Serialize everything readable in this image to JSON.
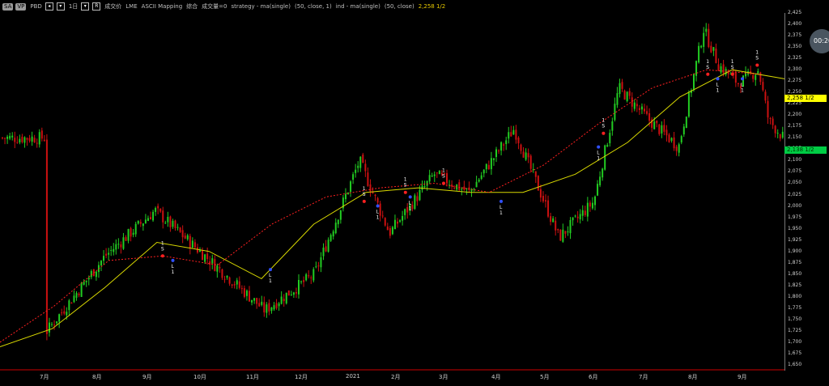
{
  "toolbar": {
    "symbol_badge": "SA",
    "vp_badge": "VP",
    "pbd_label": "PBD",
    "timeframe": "1日",
    "trade_label": "成交价",
    "exchange": "LME",
    "mapping": "ASCII Mapping",
    "composite": "综合",
    "volume_label": "成交量=0",
    "strategy_label": "strategy - ma(single)",
    "strategy_params": "(50, close, 1)",
    "ind_label": "ind - ma(single)",
    "ind_params": "(50, close)",
    "last_value": "2,258 1/2"
  },
  "clock": "00:20",
  "price_axis": {
    "ticks": [
      "2,425",
      "2,400",
      "2,375",
      "2,350",
      "2,325",
      "2,300",
      "2,275",
      "2,250",
      "2,225",
      "2,200",
      "2,175",
      "2,150",
      "2,125",
      "2,100",
      "2,075",
      "2,050",
      "2,025",
      "2,000",
      "1,975",
      "1,950",
      "1,925",
      "1,900",
      "1,875",
      "1,850",
      "1,825",
      "1,800",
      "1,775",
      "1,750",
      "1,725",
      "1,700",
      "1,675",
      "1,650"
    ],
    "last_tag": "2,258 1/2",
    "ma_tag": "2,138 1/2"
  },
  "date_axis": {
    "labels": [
      "7月",
      "8月",
      "9月",
      "10月",
      "11月",
      "12月",
      "2021",
      "2月",
      "3月",
      "4月",
      "5月",
      "6月",
      "7月",
      "8月",
      "9月"
    ]
  },
  "colors": {
    "up": "#22cc22",
    "down": "#cc1111",
    "ma_yellow": "#d8d800",
    "strategy_red": "#ff2020",
    "background": "#000000"
  },
  "chart_data": {
    "type": "candlestick",
    "ylim": [
      1650,
      2425
    ],
    "anchors_month_index": [
      0,
      1.2,
      2.2,
      3.3,
      4.4,
      5.4,
      6.3,
      6.9,
      7.8,
      8.5,
      9.4,
      10.3,
      11.0,
      11.5,
      12.1,
      12.7,
      13.2,
      13.5,
      13.9,
      14.3,
      14.5,
      14.8
    ],
    "anchors_price": [
      1720,
      1890,
      1990,
      1880,
      1770,
      1850,
      2100,
      1940,
      2070,
      2030,
      2170,
      1930,
      2010,
      2260,
      2190,
      2130,
      2390,
      2310,
      2270,
      2300,
      2190,
      2150
    ],
    "ma_yellow": [
      1690,
      1730,
      1820,
      1920,
      1900,
      1840,
      1960,
      2030,
      2040,
      2030,
      2030,
      2070,
      2140,
      2240,
      2300,
      2280
    ],
    "strategy_red": [
      1700,
      1780,
      1880,
      1890,
      1870,
      1960,
      2020,
      2040,
      2050,
      2030,
      2090,
      2180,
      2260,
      2300,
      2290
    ],
    "signals": [
      {
        "month": 2.3,
        "price": 1890,
        "label": "1 S"
      },
      {
        "month": 2.5,
        "price": 1880,
        "label": "L 1"
      },
      {
        "month": 4.4,
        "price": 1860,
        "label": "L 1"
      },
      {
        "month": 6.3,
        "price": 2010,
        "label": "1 S"
      },
      {
        "month": 6.6,
        "price": 2000,
        "label": "L 1"
      },
      {
        "month": 7.2,
        "price": 2030,
        "label": "1 S"
      },
      {
        "month": 7.3,
        "price": 2020,
        "label": "L 1"
      },
      {
        "month": 8.0,
        "price": 2050,
        "label": "1 S"
      },
      {
        "month": 9.1,
        "price": 2010,
        "label": "L 1"
      },
      {
        "month": 11.1,
        "price": 2130,
        "label": "L 1"
      },
      {
        "month": 11.2,
        "price": 2160,
        "label": "1 S"
      },
      {
        "month": 13.3,
        "price": 2290,
        "label": "1 S"
      },
      {
        "month": 13.5,
        "price": 2280,
        "label": "L 1"
      },
      {
        "month": 13.8,
        "price": 2290,
        "label": "1 S"
      },
      {
        "month": 14.0,
        "price": 2280,
        "label": "L 1"
      },
      {
        "month": 14.3,
        "price": 2310,
        "label": "1 S"
      }
    ]
  }
}
